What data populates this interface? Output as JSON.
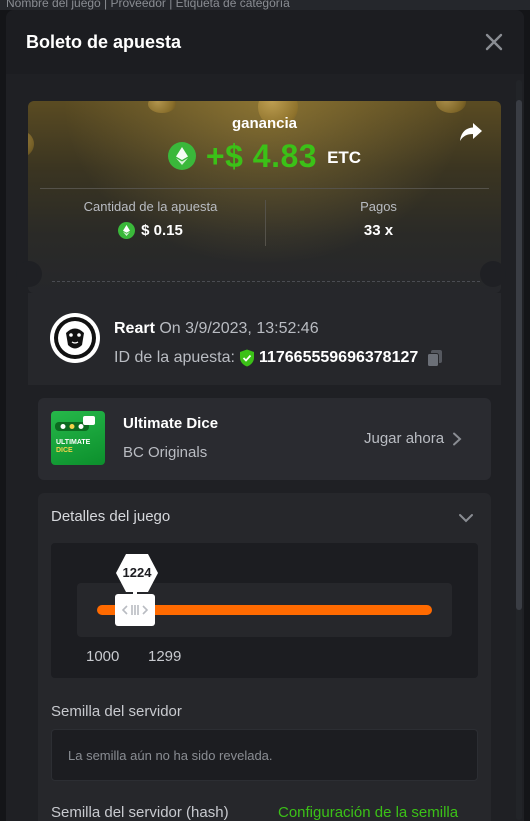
{
  "backdrop": {
    "strip_text": "Nombre del juego | Proveedor | Etiqueta de categoría"
  },
  "modal": {
    "title": "Boleto de apuesta"
  },
  "ticket": {
    "gain_label": "ganancia",
    "gain_amount": "+$ 4.83",
    "currency": "ETC",
    "bet_amount_label": "Cantidad de la apuesta",
    "bet_amount_value": "$ 0.15",
    "payout_label": "Pagos",
    "payout_value": "33 x"
  },
  "player": {
    "name": "Reart",
    "date": "On 3/9/2023, 13:52:46",
    "bet_id_label": "ID de la apuesta:",
    "bet_id_value": "117665559696378127"
  },
  "game": {
    "name": "Ultimate Dice",
    "provider": "BC Originals",
    "play_label": "Jugar ahora",
    "thumb_text_1": "ULTIMATE",
    "thumb_text_2": "DICE"
  },
  "details": {
    "title": "Detalles del juego",
    "result_value": "1224",
    "range_min": "1000",
    "range_max": "1299",
    "server_seed_label": "Semilla del servidor",
    "server_seed_placeholder": "La semilla aún no ha sido revelada.",
    "server_seed_hash_label": "Semilla del servidor (hash)",
    "seed_config_link": "Configuración de la semilla"
  },
  "colors": {
    "accent_green": "#3bc117",
    "slider_orange": "#ff6a00",
    "etc_coin": "#3ab83a"
  },
  "icons": [
    "close-icon",
    "share-icon",
    "etc-coin-icon",
    "lion-avatar-icon",
    "verified-shield-icon",
    "copy-icon",
    "chevron-right-icon",
    "chevron-down-icon",
    "slider-grip-icon"
  ]
}
